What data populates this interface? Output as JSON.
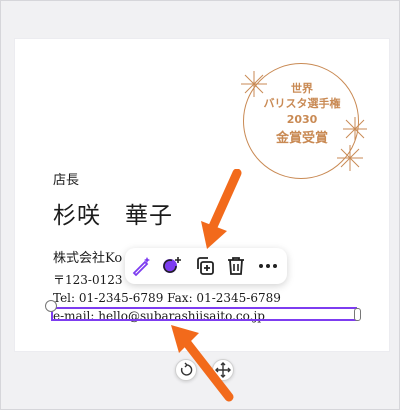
{
  "card": {
    "seal": {
      "line1": "世界",
      "line2": "バリスタ選手権",
      "line3": "2030",
      "line4": "金賞受賞",
      "color": "#c98a54"
    },
    "title": "店長",
    "name": "杉咲　華子",
    "company": "株式会社Ko",
    "address": "〒123-0123",
    "tel_fax": "Tel:  01-2345-6789    Fax:  01-2345-6789",
    "email": "e-mail:  hello@subarashiisaito.co.jp"
  },
  "toolbar": {
    "icons": [
      "magic-edit-icon",
      "comment-add-icon",
      "duplicate-icon",
      "delete-icon",
      "more-icon"
    ]
  },
  "canvas_controls": {
    "icons": [
      "rotate-icon",
      "move-icon"
    ]
  },
  "colors": {
    "accent": "#7d3cf0",
    "arrow": "#f26a1b"
  }
}
